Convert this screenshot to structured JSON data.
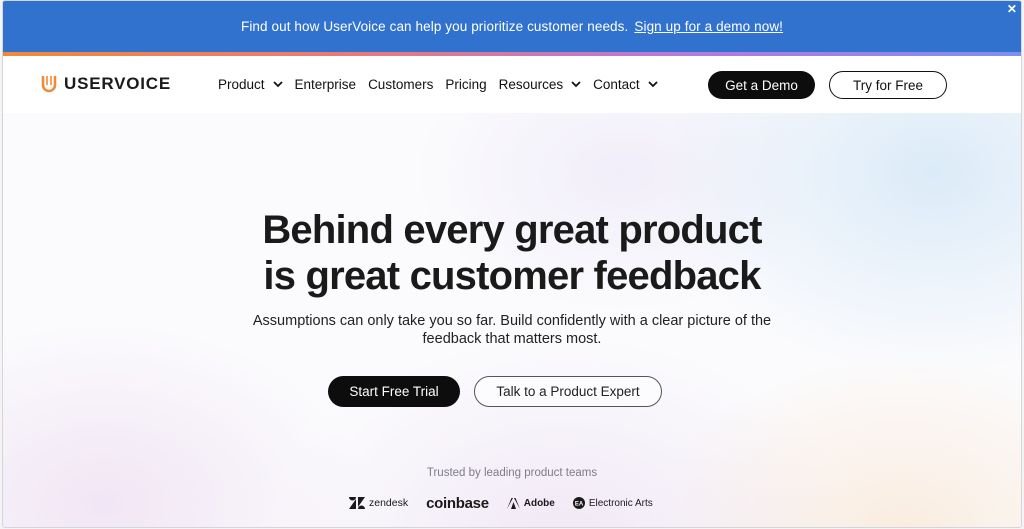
{
  "announcement": {
    "message": "Find out how UserVoice can help you prioritize customer needs.",
    "cta": "Sign up for a demo now!",
    "close_icon": "close-icon"
  },
  "nav": {
    "logo_text": "USERVOICE",
    "logo_icon": "uservoice-logo-icon",
    "items": [
      {
        "label": "Product",
        "dropdown": true
      },
      {
        "label": "Enterprise",
        "dropdown": false
      },
      {
        "label": "Customers",
        "dropdown": false
      },
      {
        "label": "Pricing",
        "dropdown": false
      },
      {
        "label": "Resources",
        "dropdown": true
      },
      {
        "label": "Contact",
        "dropdown": true
      }
    ],
    "demo_button": "Get a Demo",
    "try_button": "Try for Free"
  },
  "hero": {
    "headline_line1": "Behind every great product",
    "headline_line2": "is great customer feedback",
    "subhead_line1": "Assumptions can only take you so far. Build confidently with a clear picture of the",
    "subhead_line2": "feedback that matters most.",
    "primary_button": "Start Free Trial",
    "secondary_button": "Talk to a Product Expert"
  },
  "trusted": {
    "label": "Trusted by leading product teams",
    "logos": [
      "zendesk",
      "coinbase",
      "Adobe",
      "Electronic Arts"
    ]
  },
  "colors": {
    "announcement_bg": "#3272cf",
    "accent_orange": "#f08a3a",
    "button_dark": "#0d0d0d"
  }
}
